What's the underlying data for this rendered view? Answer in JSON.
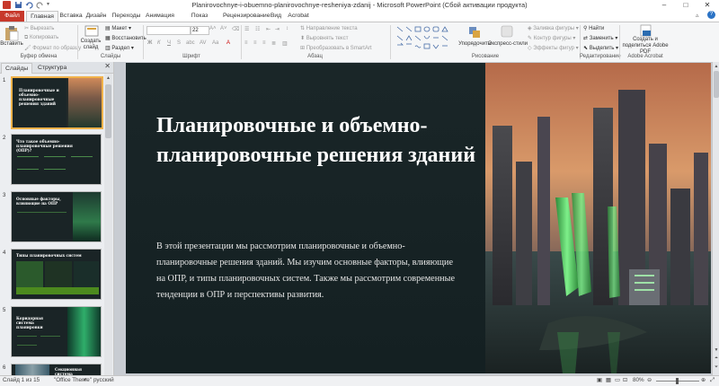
{
  "window": {
    "title": "Planirovochnye-i-obuemno-planirovochnye-resheniya-zdanij - Microsoft PowerPoint (Сбой активации продукта)",
    "minimize": "–",
    "maximize": "□",
    "close": "✕"
  },
  "tabs": [
    "Файл",
    "Главная",
    "Вставка",
    "Дизайн",
    "Переходы",
    "Анимация",
    "Показ слайдов",
    "Рецензирование",
    "Вид",
    "Acrobat"
  ],
  "ribbon": {
    "clipboard": {
      "paste": "Вставить",
      "cut": "Вырезать",
      "copy": "Копировать",
      "format_painter": "Формат по образцу",
      "label": "Буфер обмена"
    },
    "slides": {
      "new_slide": "Создать слайд",
      "layout": "Макет",
      "reset": "Восстановить",
      "section": "Раздел",
      "label": "Слайды"
    },
    "font": {
      "font_size": "22",
      "bold": "Ж",
      "italic": "К",
      "underline": "Ч",
      "strike": "S",
      "shadow": "abc",
      "label": "Шрифт"
    },
    "paragraph": {
      "text_direction": "Направление текста",
      "align_text": "Выровнять текст",
      "smartart": "Преобразовать в SmartArt",
      "label": "Абзац"
    },
    "drawing": {
      "arrange": "Упорядочить",
      "quick_styles": "Экспресс-стили",
      "shape_fill": "Заливка фигуры",
      "shape_outline": "Контур фигуры",
      "shape_effects": "Эффекты фигур",
      "label": "Рисование"
    },
    "editing": {
      "find": "Найти",
      "replace": "Заменить",
      "select": "Выделить",
      "label": "Редактирование"
    },
    "acrobat": {
      "create_share": "Создать и поделиться Adobe PDF",
      "label": "Adobe Acrobat"
    }
  },
  "left_panel": {
    "tabs": [
      "Слайды",
      "Структура"
    ],
    "close": "✕",
    "thumbnails": [
      {
        "num": "1",
        "title": "Планировочные и объемно-планировочные решения зданий"
      },
      {
        "num": "2",
        "title": "Что такое объемно-планировочные решения (ОПР)?"
      },
      {
        "num": "3",
        "title": "Основные факторы, влияющие на ОПР"
      },
      {
        "num": "4",
        "title": "Типы планировочных систем"
      },
      {
        "num": "5",
        "title": "Коридорная система планировки"
      },
      {
        "num": "6",
        "title": "Секционная система планировки"
      }
    ]
  },
  "slide": {
    "title": "Планировочные и объемно-планировочные решения зданий",
    "body": "В этой презентации мы рассмотрим планировочные и объемно-планировочные решения зданий. Мы изучим основные факторы, влияющие на ОПР, и типы планировочных систем. Также мы рассмотрим современные тенденции в ОПР и перспективы развития."
  },
  "status": {
    "slide_counter": "Слайд 1 из 15",
    "theme": "\"Office Theme\"",
    "language": "русский",
    "zoom": "80%"
  },
  "colors": {
    "accent": "#c7382b",
    "slide_bg": "#172325",
    "thumb_sel": "#f0b24a"
  }
}
